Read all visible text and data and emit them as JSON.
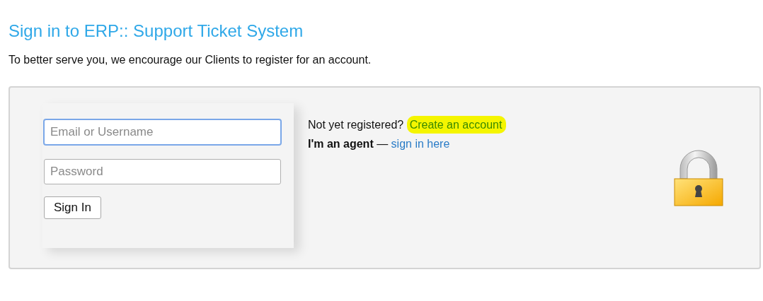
{
  "title": "Sign in to ERP:: Support Ticket System",
  "intro": "To better serve you, we encourage our Clients to register for an account.",
  "login_form": {
    "fields": [
      {
        "placeholder": "Email or Username",
        "focused": true
      },
      {
        "placeholder": "Password",
        "focused": false
      }
    ],
    "button": "Sign In"
  },
  "register_line": {
    "text": "Not yet registered? ",
    "link": "Create an account",
    "highlighted": true
  },
  "agent_line": {
    "text": "**I'm an agent** — ",
    "link": "sign in here",
    "highlighted": false
  }
}
